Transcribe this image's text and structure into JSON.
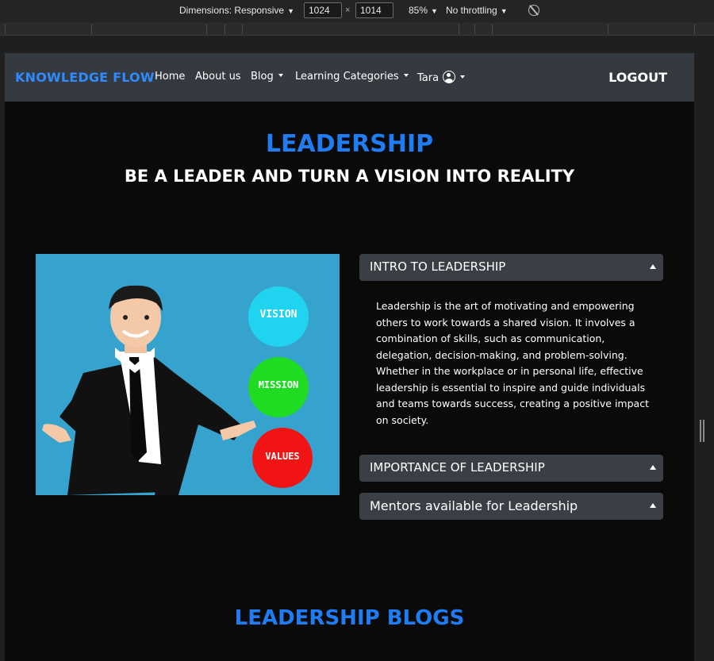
{
  "devtools": {
    "dimensions_label": "Dimensions: Responsive",
    "width": "1024",
    "height": "1014",
    "zoom": "85%",
    "throttling": "No throttling"
  },
  "navbar": {
    "brand": "KNOWLEDGE FLOW",
    "links": [
      {
        "label": "Home"
      },
      {
        "label": "About us"
      },
      {
        "label": "Blog"
      },
      {
        "label": "Learning Categories"
      },
      {
        "label": "Tara"
      }
    ],
    "logout": "LOGOUT"
  },
  "hero": {
    "title": "LEADERSHIP",
    "subtitle": "BE A LEADER AND TURN A VISION INTO REALITY"
  },
  "illustration": {
    "circles": [
      {
        "label": "VISION",
        "color": "#20d4f0"
      },
      {
        "label": "MISSION",
        "color": "#1fdc22"
      },
      {
        "label": "VALUES",
        "color": "#f01414"
      }
    ]
  },
  "accordion": {
    "sections": [
      {
        "title": "INTRO TO LEADERSHIP"
      },
      {
        "title": "IMPORTANCE OF LEADERSHIP"
      },
      {
        "title": "Mentors available for Leadership"
      }
    ],
    "intro_body": "Leadership is the art of motivating and empowering others to work towards a shared vision. It involves a combination of skills, such as communication, delegation, decision-making, and problem-solving. Whether in the workplace or in personal life, effective leadership is essential to inspire and guide individuals and teams towards success, creating a positive impact on society."
  },
  "blogs": {
    "title": "LEADERSHIP BLOGS"
  },
  "colors": {
    "accent": "#1f7cf2",
    "navbar": "#343a40",
    "page_bg": "#0a0a0a",
    "accordion_header": "#3a3f46"
  }
}
